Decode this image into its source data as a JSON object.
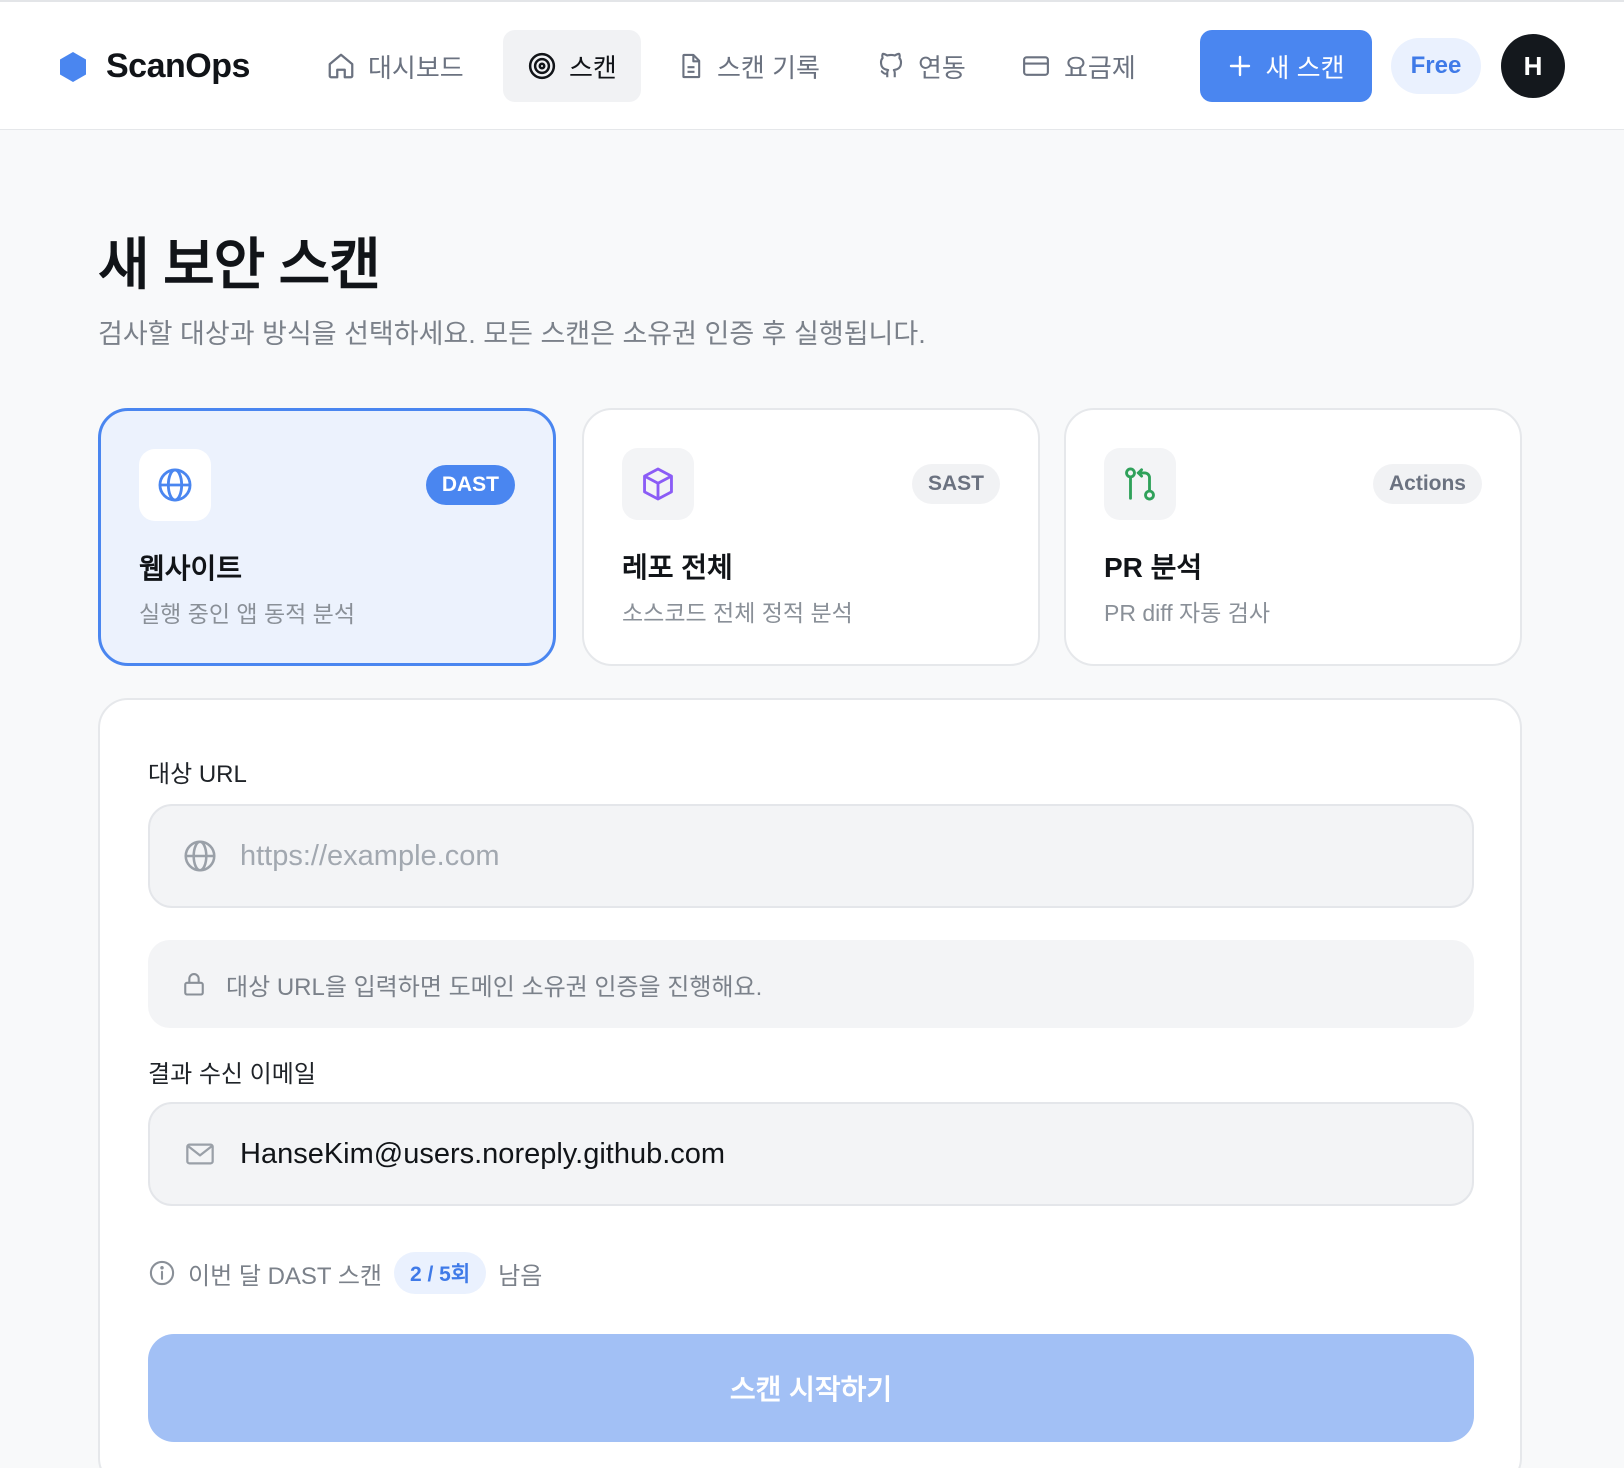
{
  "app": {
    "name": "ScanOps"
  },
  "nav": {
    "items": [
      {
        "label": "대시보드",
        "icon": "home-icon",
        "active": false
      },
      {
        "label": "스캔",
        "icon": "target-icon",
        "active": true
      },
      {
        "label": "스캔 기록",
        "icon": "document-icon",
        "active": false
      },
      {
        "label": "연동",
        "icon": "github-icon",
        "active": false
      },
      {
        "label": "요금제",
        "icon": "credit-card-icon",
        "active": false
      }
    ],
    "new_scan_label": "새 스캔",
    "plan_badge": "Free",
    "avatar_initial": "H"
  },
  "page": {
    "title": "새 보안 스캔",
    "subtitle": "검사할 대상과 방식을 선택하세요. 모든 스캔은 소유권 인증 후 실행됩니다."
  },
  "scan_types": [
    {
      "title": "웹사이트",
      "description": "실행 중인 앱 동적 분석",
      "tag": "DAST",
      "icon": "globe-icon",
      "selected": true
    },
    {
      "title": "레포 전체",
      "description": "소스코드 전체 정적 분석",
      "tag": "SAST",
      "icon": "cube-icon",
      "selected": false
    },
    {
      "title": "PR 분석",
      "description": "PR diff 자동 검사",
      "tag": "Actions",
      "icon": "pull-request-icon",
      "selected": false
    }
  ],
  "form": {
    "url_label": "대상 URL",
    "url_placeholder": "https://example.com",
    "url_value": "",
    "verify_notice": "대상 URL을 입력하면 도메인 소유권 인증을 진행해요.",
    "email_label": "결과 수신 이메일",
    "email_value": "HanseKim@users.noreply.github.com",
    "quota_prefix": "이번 달 DAST 스캔",
    "quota_value": "2 / 5회",
    "quota_suffix": "남음",
    "start_button": "스캔 시작하기"
  },
  "colors": {
    "accent": "#4a86f0",
    "accent_disabled": "#a2c0f5",
    "selected_card_bg": "#ecf2fd",
    "badge_bg": "#eaf1fe",
    "avatar_bg": "#14181d"
  }
}
